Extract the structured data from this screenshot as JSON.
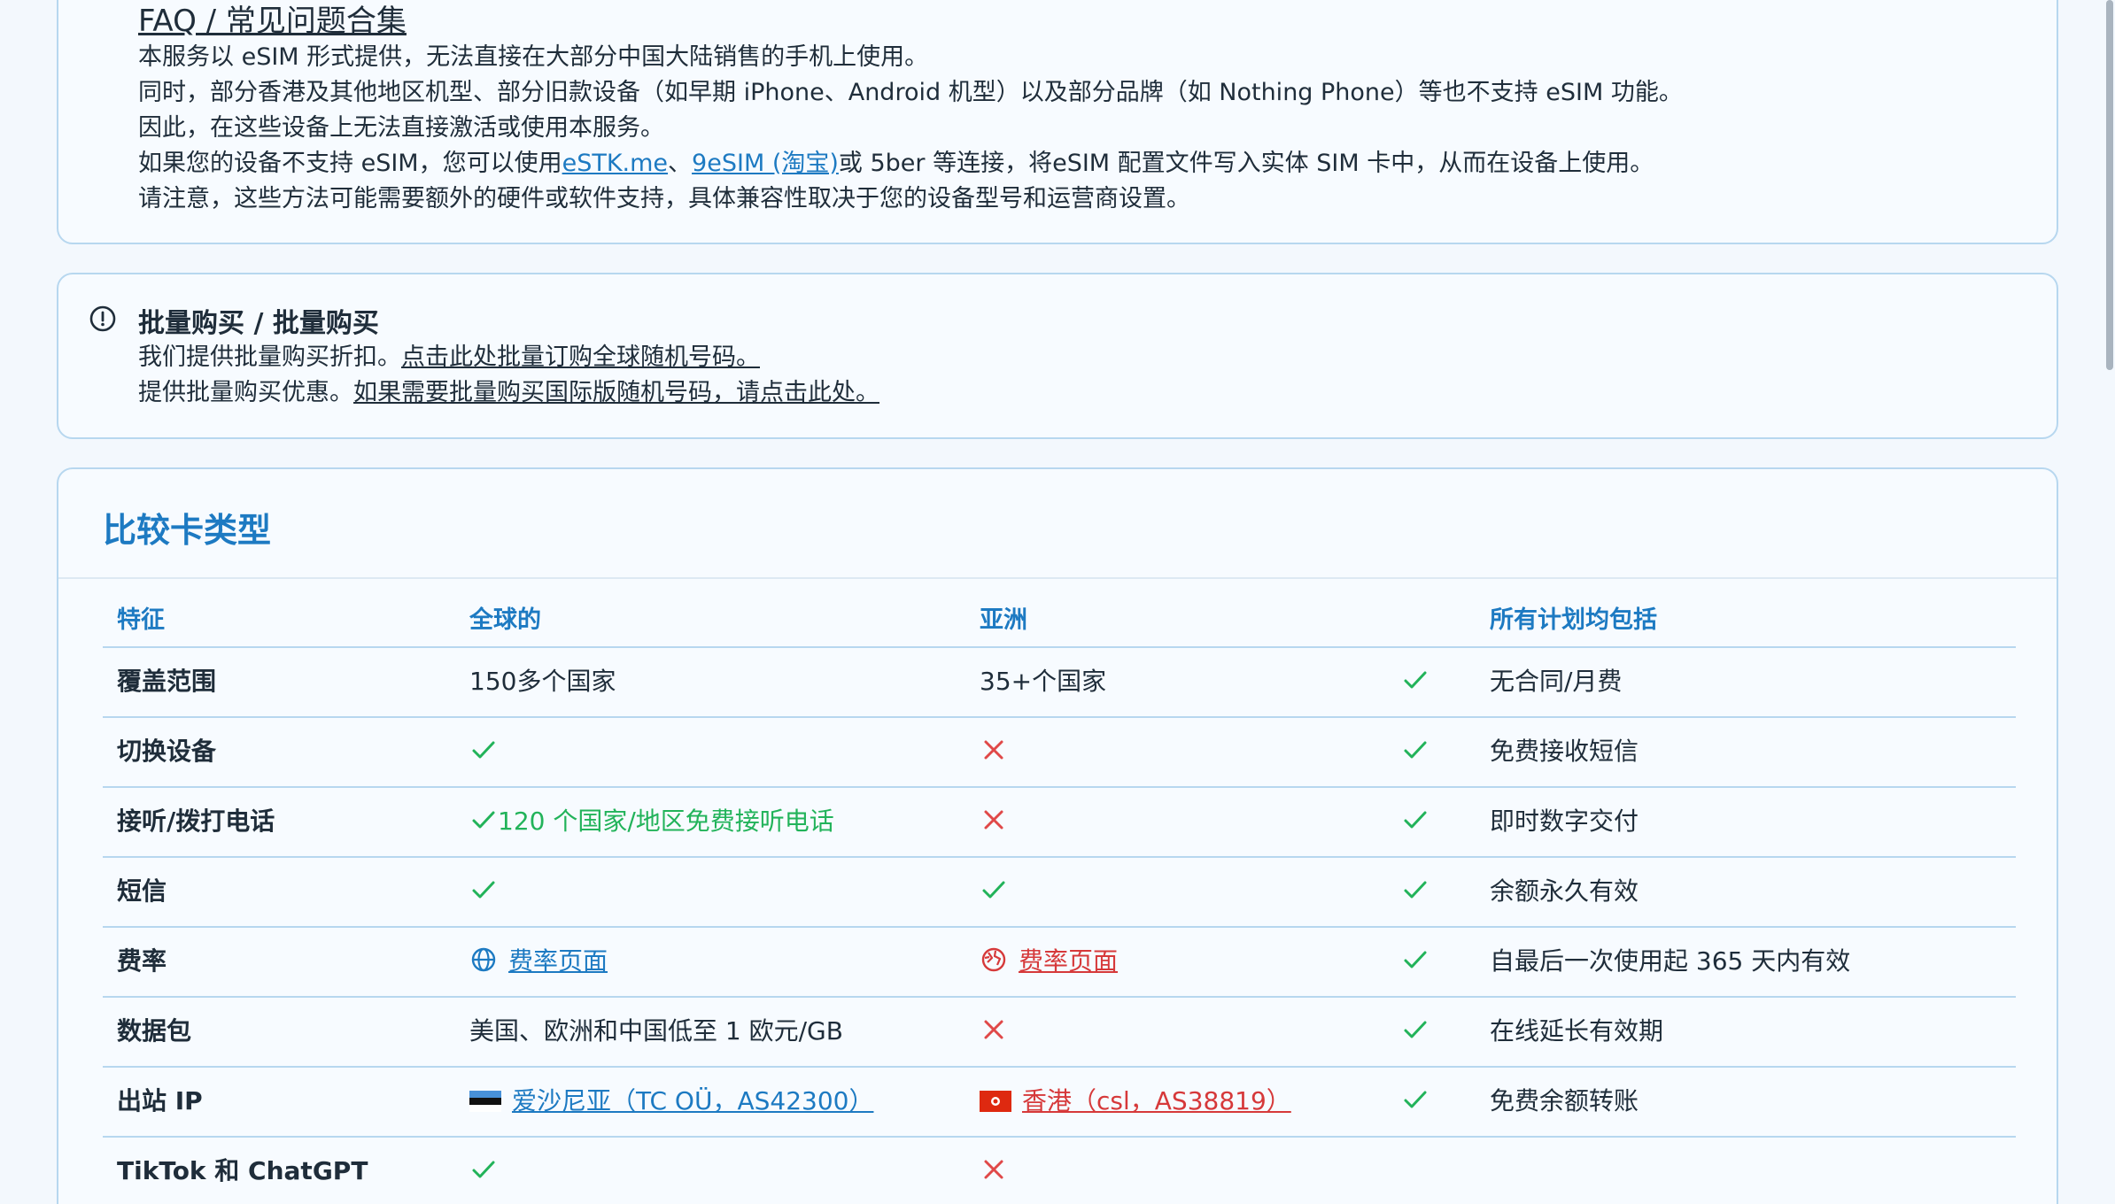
{
  "faq": {
    "title": "FAQ / 常见问题合集",
    "line1": "本服务以 eSIM 形式提供，无法直接在大部分中国大陆销售的手机上使用。",
    "line2": "同时，部分香港及其他地区机型、部分旧款设备（如早期 iPhone、Android 机型）以及部分品牌（如 Nothing Phone）等也不支持 eSIM 功能。",
    "line3": "因此，在这些设备上无法直接激活或使用本服务。",
    "line4_prefix": "如果您的设备不支持 eSIM，您可以使用",
    "line4_link1": "eSTK.me",
    "line4_sep": "、",
    "line4_link2": "9eSIM (淘宝)",
    "line4_suffix": "或 5ber 等连接，将eSIM 配置文件写入实体 SIM 卡中，从而在设备上使用。",
    "line5": "请注意，这些方法可能需要额外的硬件或软件支持，具体兼容性取决于您的设备型号和运营商设置。"
  },
  "bulk": {
    "title": "批量购买 / 批量购买",
    "line1_prefix": "我们提供批量购买折扣。",
    "line1_link": "点击此处批量订购全球随机号码。",
    "line2_prefix": "提供批量购买优惠。",
    "line2_link": "如果需要批量购买国际版随机号码，请点击此处。",
    "icon": "info-circle-icon"
  },
  "compare": {
    "title": "比较卡类型",
    "headers": {
      "feature": "特征",
      "global": "全球的",
      "asia": "亚洲",
      "included": "所有计划均包括"
    },
    "rows": [
      {
        "feature": "覆盖范围",
        "global_text": "150多个国家",
        "asia_text": "35+个国家"
      },
      {
        "feature": "切换设备",
        "global": "check",
        "asia": "cross"
      },
      {
        "feature": "接听/拨打电话",
        "global": "check",
        "global_text": "120 个国家/地区免费接听电话",
        "asia": "cross"
      },
      {
        "feature": "短信",
        "global": "check",
        "asia": "check"
      },
      {
        "feature": "费率",
        "global_link": "费率页面",
        "asia_link": "费率页面"
      },
      {
        "feature": "数据包",
        "global_text": "美国、欧洲和中国低至 1 欧元/GB",
        "asia": "cross"
      },
      {
        "feature": "出站 IP",
        "global_link": "爱沙尼亚（TC OÜ，AS42300）",
        "asia_link": "香港（csl，AS38819）"
      },
      {
        "feature": "TikTok 和 ChatGPT",
        "global": "check",
        "asia": "cross"
      }
    ],
    "included": [
      "无合同/月费",
      "免费接收短信",
      "即时数字交付",
      "余额永久有效",
      "自最后一次使用起 365 天内有效",
      "在线延长有效期",
      "免费余额转账"
    ]
  },
  "colors": {
    "accent": "#1d7ac2",
    "check": "#22b35a",
    "cross": "#e04848",
    "asia_link": "#d6393a"
  }
}
